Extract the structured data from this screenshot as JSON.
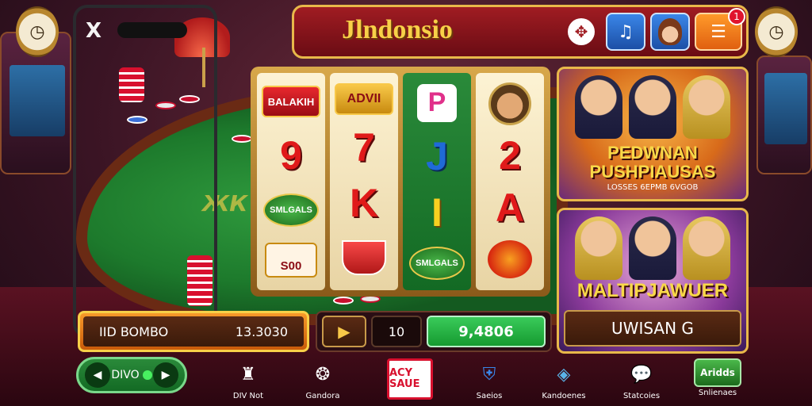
{
  "header": {
    "title": "Jlndonsio",
    "notification_count": "1",
    "icons": {
      "settings": "gear-icon",
      "music": "music-icon",
      "avatar": "avatar-icon",
      "menu": "menu-icon"
    }
  },
  "phone": {
    "close_label": "X"
  },
  "table": {
    "logo_text": "ЖК"
  },
  "reels": [
    {
      "style": "cream",
      "symbols": [
        "BALAKIH",
        "9",
        "SMLGALS",
        "S00"
      ]
    },
    {
      "style": "cream",
      "symbols": [
        "ADVII",
        "7",
        "K",
        ""
      ]
    },
    {
      "style": "green",
      "symbols": [
        "P",
        "J",
        "I",
        "SMLGALS"
      ]
    },
    {
      "style": "cream",
      "symbols": [
        "",
        "2",
        "A",
        ""
      ]
    }
  ],
  "promo_top": {
    "title_line1": "PEDWNAN",
    "title_line2": "PUSHPIAUSAS",
    "subtitle": "LOSSES 6EPMB 6VGOB"
  },
  "promo_bottom": {
    "title": "MALTIPJAWUER",
    "button_label": "UWISAN G"
  },
  "bonus": {
    "label": "IID BOMBO",
    "value": "13.3030"
  },
  "controls": {
    "play_icon": "play-icon",
    "lines_value": "10",
    "win_value": "9,4806"
  },
  "toggle": {
    "label": "DIVO"
  },
  "nav": [
    {
      "label": "DIV Not",
      "icon": "tower-icon"
    },
    {
      "label": "Gandora",
      "icon": "emblem-icon"
    },
    {
      "label": "ACY SAUE",
      "icon": "logo-icon"
    },
    {
      "label": "Saeios",
      "icon": "shield-icon"
    },
    {
      "label": "Kandoenes",
      "icon": "badge-icon"
    },
    {
      "label": "Statcoies",
      "icon": "chat-icon"
    },
    {
      "label": "Snlienaes",
      "icon": "trophy-icon"
    }
  ],
  "nav_extra": {
    "snlienaes_badge": "Aridds"
  },
  "colors": {
    "header_red": "#a01c22",
    "gold": "#e8b84a",
    "table_green": "#1d7a2c",
    "win_green": "#2ab84a"
  }
}
